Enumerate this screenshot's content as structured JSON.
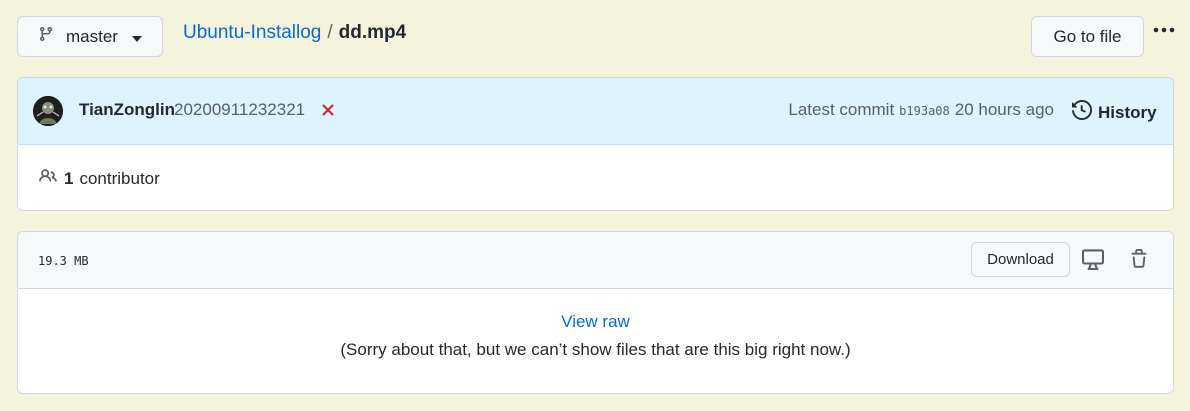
{
  "branch": {
    "name": "master"
  },
  "breadcrumb": {
    "repo": "Ubuntu-Installog",
    "separator": "/",
    "file": "dd.mp4"
  },
  "toolbar": {
    "goto_file_label": "Go to file",
    "more_icon": "kebab-horizontal-icon"
  },
  "commit": {
    "author": "TianZonglin",
    "message": "20200911232321",
    "status": "failed",
    "latest_label": "Latest commit",
    "sha": "b193a08",
    "time": "20 hours ago",
    "history_label": "History"
  },
  "contributors": {
    "count": "1",
    "label": "contributor"
  },
  "file": {
    "size": "19.3 MB",
    "download_label": "Download",
    "view_raw_label": "View raw",
    "too_big_message": "(Sorry about that, but we can’t show files that are this big right now.)"
  },
  "colors": {
    "page_bg": "#f4f3dc",
    "link": "#0969da",
    "commit_header_bg": "#ddf4ff",
    "status_failed": "#cf222e"
  }
}
